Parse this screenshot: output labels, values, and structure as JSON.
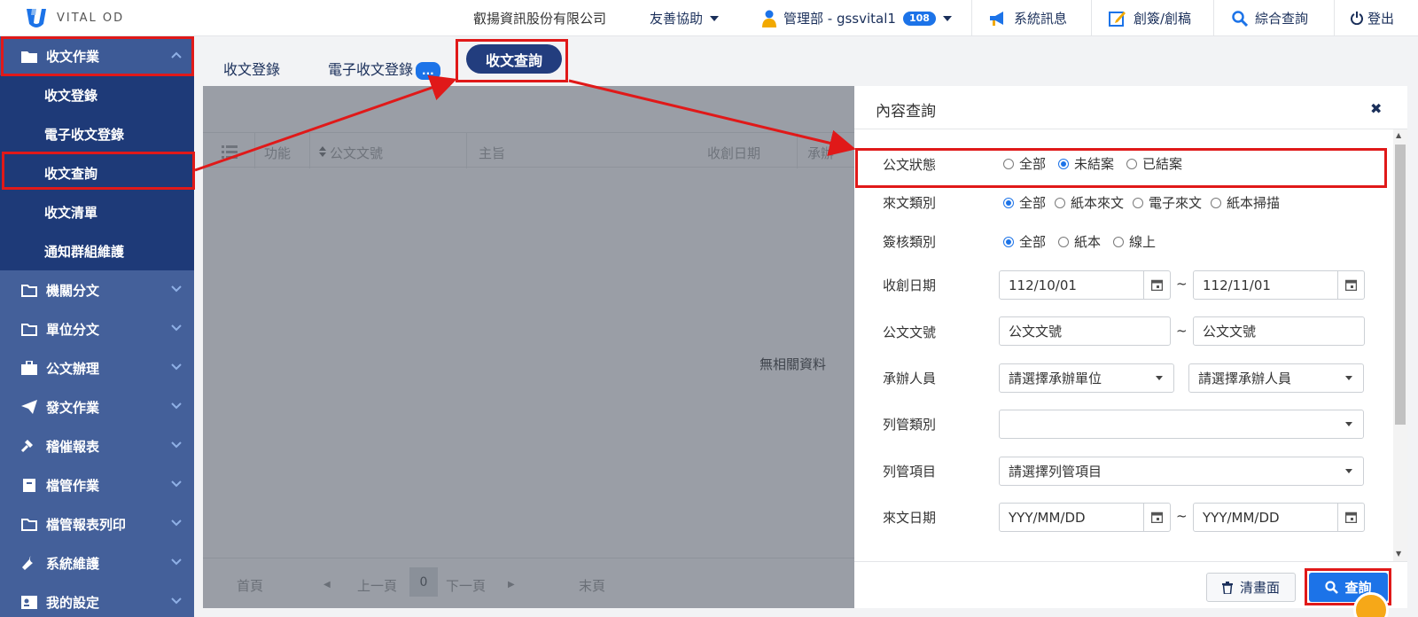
{
  "header": {
    "logo_text": "VITAL OD",
    "company": "叡揚資訊股份有限公司",
    "assist": "友善協助",
    "user": "管理部 - gssvital1",
    "user_badge": "108",
    "messages": "系統訊息",
    "draft": "創簽/創稿",
    "search": "綜合查詢",
    "logout": "登出"
  },
  "sidebar": {
    "active_section": "收文作業",
    "sub_items": [
      "收文登錄",
      "電子收文登錄",
      "收文查詢",
      "收文清單",
      "通知群組維護"
    ],
    "sections": [
      "機關分文",
      "單位分文",
      "公文辦理",
      "發文作業",
      "稽催報表",
      "檔管作業",
      "檔管報表列印",
      "系統維護",
      "我的設定"
    ]
  },
  "tabs": {
    "items": [
      "收文登錄",
      "電子收文登錄",
      "收文查詢"
    ],
    "more": "...",
    "active": "收文查詢"
  },
  "grid": {
    "columns": [
      "功能",
      "公文文號",
      "主旨",
      "收創日期",
      "承辦"
    ],
    "empty_text": "無相關資料",
    "pager": {
      "first": "首頁",
      "prev": "上一頁",
      "page": "0",
      "next": "下一頁",
      "last": "末頁"
    }
  },
  "panel": {
    "title": "內容查詢",
    "close": "✖",
    "status": {
      "label": "公文狀態",
      "options": [
        "全部",
        "未結案",
        "已結案"
      ],
      "selected": "未結案"
    },
    "source_type": {
      "label": "來文類別",
      "options": [
        "全部",
        "紙本來文",
        "電子來文",
        "紙本掃描"
      ],
      "selected": "全部"
    },
    "review_type": {
      "label": "簽核類別",
      "options": [
        "全部",
        "紙本",
        "線上"
      ],
      "selected": "全部"
    },
    "receive_date": {
      "label": "收創日期",
      "from": "112/10/01",
      "to": "112/11/01"
    },
    "doc_no": {
      "label": "公文文號",
      "from": "公文文號",
      "to": "公文文號"
    },
    "handler": {
      "label": "承辦人員",
      "unit": "請選擇承辦單位",
      "person": "請選擇承辦人員"
    },
    "track_type": {
      "label": "列管類別",
      "value": ""
    },
    "track_item": {
      "label": "列管項目",
      "value": "請選擇列管項目"
    },
    "doc_date": {
      "label": "來文日期",
      "from": "YYY/MM/DD",
      "to": "YYY/MM/DD"
    },
    "tilde": "~",
    "clear_button": "清畫面",
    "search_button": "查詢"
  },
  "colors": {
    "sidebar": "#44609a",
    "submenu": "#1e3a78",
    "accent": "#1c73e8",
    "annotation": "#e01919"
  }
}
